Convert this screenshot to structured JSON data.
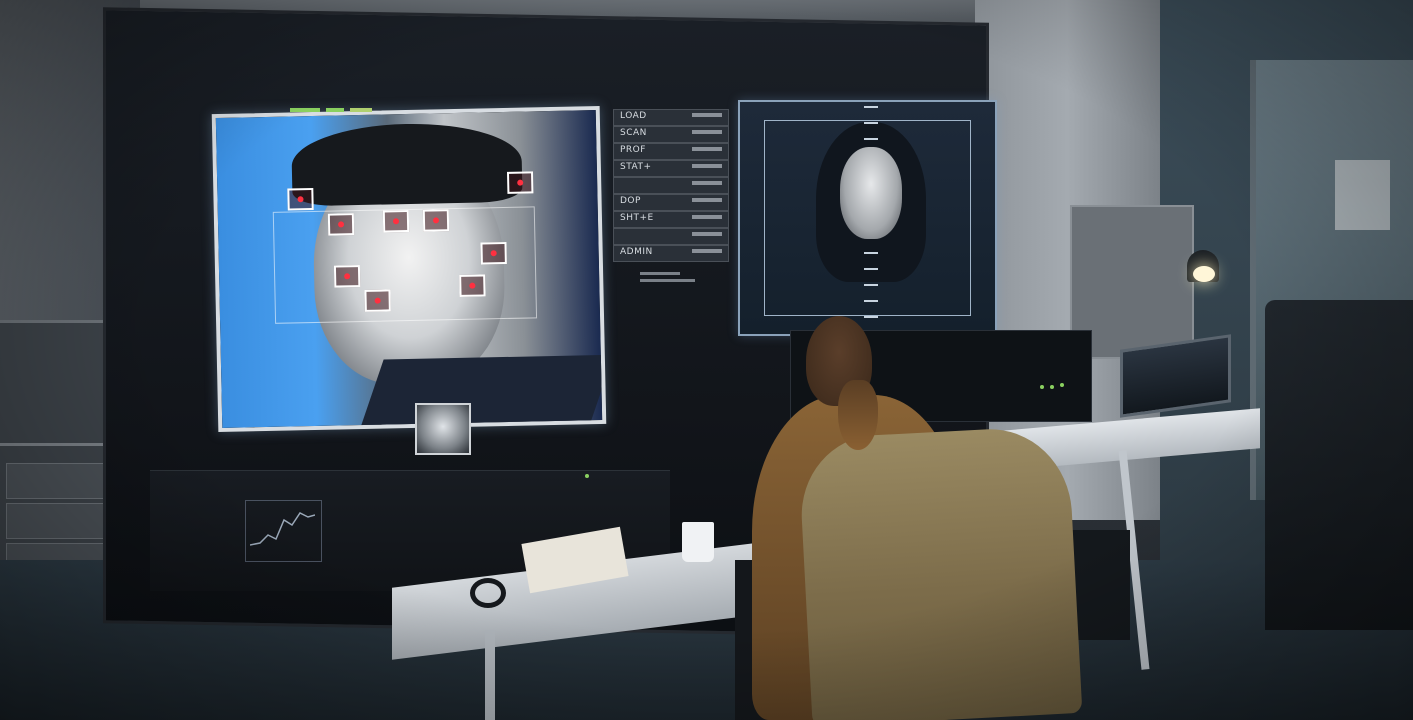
{
  "scene": {
    "description": "Surveillance / facial recognition room with a video wall showing two faces, a woman seated at a desk facing the screens",
    "colors": {
      "screen_glow": "#8aa2ba",
      "marker_red": "#ff3040",
      "meter_green": "#8ad060",
      "coat_tan": "#9a8a62"
    }
  },
  "panel": {
    "rows": [
      {
        "label": "LOAD"
      },
      {
        "label": "SCAN"
      },
      {
        "label": "PROF"
      },
      {
        "label": "STAT+"
      },
      {
        "label": ""
      },
      {
        "label": "DOP"
      },
      {
        "label": "SHT+E"
      },
      {
        "label": ""
      },
      {
        "label": "ADMIN"
      }
    ]
  }
}
